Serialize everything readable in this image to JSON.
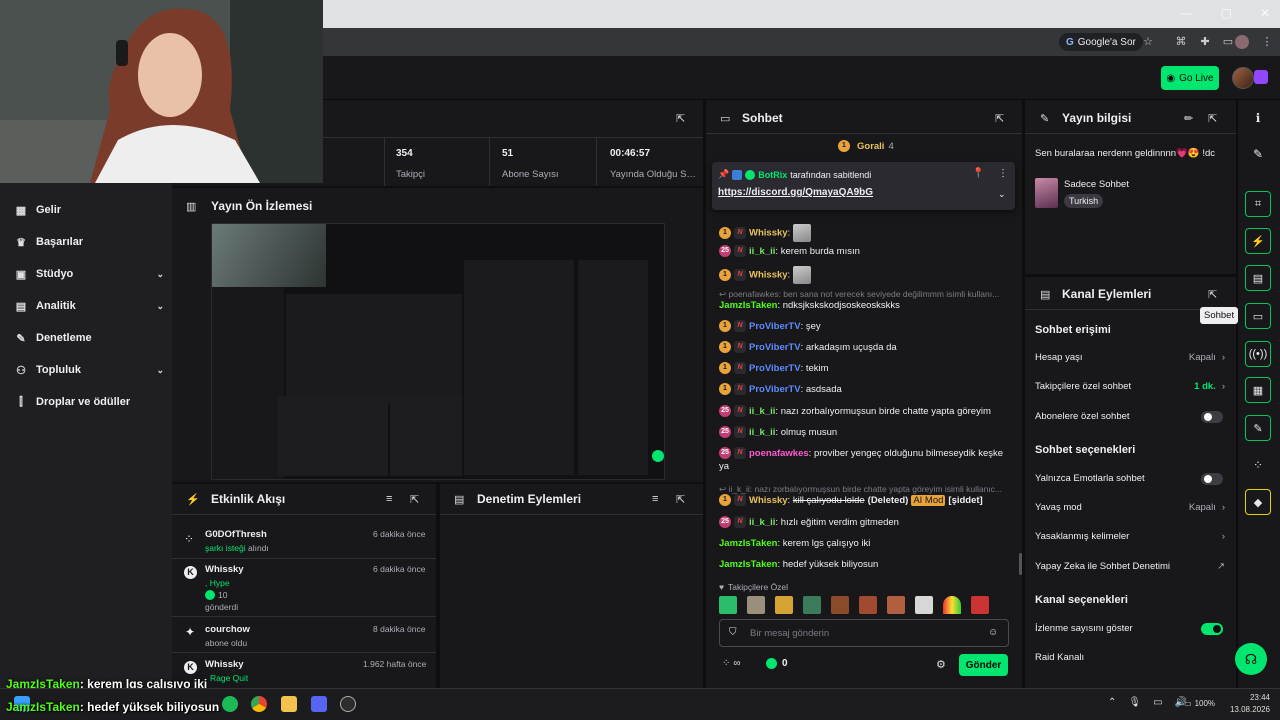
{
  "browser": {
    "search_button": "Google'a Sor",
    "window_controls": [
      "—",
      "▢",
      "✕"
    ]
  },
  "topnav": {
    "go_live": "Go Live"
  },
  "leftnav": {
    "items": [
      {
        "label": "Gelir",
        "icon": "bank-icon"
      },
      {
        "label": "Başarılar",
        "icon": "trophy-icon"
      },
      {
        "label": "Stüdyo",
        "icon": "studio-icon",
        "chevron": "⌄"
      },
      {
        "label": "Analitik",
        "icon": "analytics-icon",
        "chevron": "⌄"
      },
      {
        "label": "Denetleme",
        "icon": "wrench-icon"
      },
      {
        "label": "Topluluk",
        "icon": "community-icon",
        "chevron": "⌄"
      },
      {
        "label": "Droplar ve ödüller",
        "icon": "drops-icon"
      }
    ]
  },
  "stats": [
    {
      "value": "354",
      "label": "Takipçi"
    },
    {
      "value": "51",
      "label": "Abone Sayısı"
    },
    {
      "value": "00:46:57",
      "label": "Yayında Olduğu Süre"
    }
  ],
  "preview": {
    "title": "Yayın Ön İzlemesi"
  },
  "activity": {
    "title": "Etkinlik Akışı",
    "events": [
      {
        "name": "G0DOfThresh",
        "detail": "şarkı isteği",
        "detail2": "alındı",
        "time": "6 dakika önce",
        "icon": "shapes-icon"
      },
      {
        "name": "Whissky",
        "detail": ", Hype",
        "detail2": "10",
        "detail3": "gönderdi",
        "time": "6 dakika önce",
        "icon": "kick-icon"
      },
      {
        "name": "courchow",
        "detail": "abone oldu",
        "time": "8 dakika önce",
        "icon": "sparkle-icon"
      },
      {
        "name": "Whissky",
        "detail": "Rage Quit",
        "time": "1.962 hafta önce",
        "icon": "kick-icon"
      }
    ]
  },
  "moderation": {
    "title": "Denetim Eylemleri"
  },
  "chat": {
    "title": "Sohbet",
    "top_chatter": "Gorali",
    "top_count": "4",
    "pinned": {
      "by": "BotRix",
      "by_suffix": "tarafından sabitlendi",
      "link": "https://discord.gg/QmayaQA9bG"
    },
    "messages": [
      {
        "type": "msg",
        "badges": [
          "1",
          "N"
        ],
        "user": "Whissky",
        "color": "#e8c25a",
        "text": "",
        "emote": true
      },
      {
        "type": "msg",
        "badges": [
          "25",
          "N"
        ],
        "user": "ii_k_ii",
        "color": "#7ce26a",
        "text": ": kerem burda mısın"
      },
      {
        "type": "msg",
        "badges": [
          "1",
          "N"
        ],
        "user": "Whissky",
        "color": "#e8c25a",
        "text": "",
        "emote": true
      },
      {
        "type": "reply",
        "text": "↩ poenafawkes: ben sana not verecek seviyede değilimmm isimli kullanı..."
      },
      {
        "type": "msg",
        "badges": [],
        "user": "JamzIsTaken",
        "color": "#53fc18",
        "text": ": ndksjkskskodjsoskeoskskks"
      },
      {
        "type": "msg",
        "badges": [
          "1",
          "N"
        ],
        "user": "ProViberTV",
        "color": "#5c8cff",
        "text": ": şey"
      },
      {
        "type": "msg",
        "badges": [
          "1",
          "N"
        ],
        "user": "ProViberTV",
        "color": "#5c8cff",
        "text": ": arkadaşım uçuşda da"
      },
      {
        "type": "msg",
        "badges": [
          "1",
          "N"
        ],
        "user": "ProViberTV",
        "color": "#5c8cff",
        "text": ": tekim"
      },
      {
        "type": "msg",
        "badges": [
          "1",
          "N"
        ],
        "user": "ProViberTV",
        "color": "#5c8cff",
        "text": ": asdsada"
      },
      {
        "type": "msg",
        "badges": [
          "25",
          "N"
        ],
        "user": "ii_k_ii",
        "color": "#7ce26a",
        "text": ": nazı zorbalıyormuşsun birde chatte yapta göreyim"
      },
      {
        "type": "msg",
        "badges": [
          "25",
          "N"
        ],
        "user": "ii_k_ii",
        "color": "#7ce26a",
        "text": ": olmuş musun"
      },
      {
        "type": "msg",
        "badges": [
          "25",
          "N"
        ],
        "user": "poenafawkes",
        "color": "#ff5ad1",
        "text": ": proviber yengeç olduğunu bilmeseydik keşke ya"
      },
      {
        "type": "reply",
        "text": "↩ ii_k_ii: nazı zorbalıyormuşsun birde chatte yapta göreyim isimli kullanıc..."
      },
      {
        "type": "deleted",
        "badges": [
          "1",
          "N"
        ],
        "user": "Whissky",
        "color": "#e8c25a",
        "text": "kill çalıyodu lolde",
        "deleted_label": "(Deleted)",
        "mod_label": "AI Mod",
        "reason": "[şiddet]"
      },
      {
        "type": "msg",
        "badges": [
          "25",
          "N"
        ],
        "user": "ii_k_ii",
        "color": "#7ce26a",
        "text": ": hızlı eğitim verdim gitmeden"
      },
      {
        "type": "msg",
        "badges": [],
        "user": "JamzIsTaken",
        "color": "#53fc18",
        "text": ": kerem lgs çalışıyo iki"
      },
      {
        "type": "msg",
        "badges": [],
        "user": "JamzIsTaken",
        "color": "#53fc18",
        "text": ": hedef yüksek biliyosun"
      }
    ],
    "followers_only": "Takipçilere Özel",
    "input_placeholder": "Bir mesaj gönderin",
    "infinity": "∞",
    "points": "0",
    "send": "Gönder"
  },
  "stream_info": {
    "title": "Yayın bilgisi",
    "stream_title": "Sen buralaraa nerdenn geldinnnn💗😍 !dc",
    "category": "Sadece Sohbet",
    "language_tag": "Turkish"
  },
  "channel_actions": {
    "title": "Kanal Eylemleri",
    "sections": [
      {
        "heading": "Sohbet erişimi",
        "rows": [
          {
            "label": "Hesap yaşı",
            "value": "Kapalı",
            "control": "chevron"
          },
          {
            "label": "Takipçilere özel sohbet",
            "value": "1 dk.",
            "control": "chevron",
            "value_color": "#00e66e"
          },
          {
            "label": "Abonelere özel sohbet",
            "value": "",
            "control": "toggle-off"
          }
        ]
      },
      {
        "heading": "Sohbet seçenekleri",
        "rows": [
          {
            "label": "Yalnızca Emotlarla sohbet",
            "value": "",
            "control": "toggle-off"
          },
          {
            "label": "Yavaş mod",
            "value": "Kapalı",
            "control": "chevron"
          },
          {
            "label": "Yasaklanmış kelimeler",
            "value": "",
            "control": "chevron"
          },
          {
            "label": "Yapay Zeka ile Sohbet Denetimi",
            "value": "",
            "control": "external"
          }
        ]
      },
      {
        "heading": "Kanal seçenekleri",
        "rows": [
          {
            "label": "İzlenme sayısını göster",
            "value": "",
            "control": "toggle-on"
          },
          {
            "label": "Raid Kanalı",
            "value": "",
            "control": "none"
          }
        ]
      }
    ]
  },
  "rightbar": {
    "tooltip": "Sohbet"
  },
  "overlay_chat": [
    {
      "user": "JamzIsTaken",
      "text": ": kerem lgs çalışıyo iki"
    },
    {
      "user": "JamzIsTaken",
      "text": ": hedef yüksek biliyosun"
    }
  ],
  "taskbar": {
    "battery": "100%",
    "time": "23:44",
    "date": "13.08.2026"
  },
  "colors": {
    "accent": "#00e66e",
    "panel": "#18181b",
    "background": "#0e0e10"
  }
}
